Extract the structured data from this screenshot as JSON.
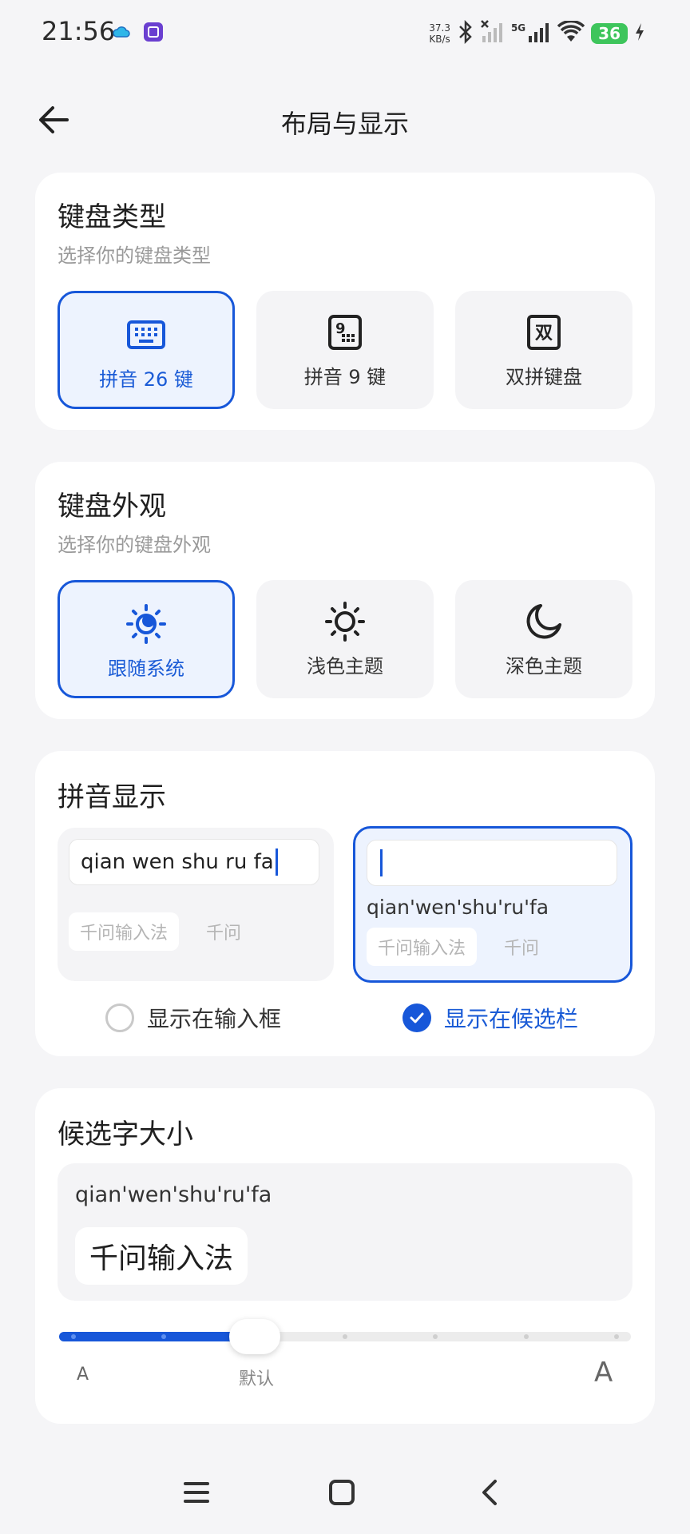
{
  "status_bar": {
    "time": "21:56",
    "net_speed_value": "37.3",
    "net_speed_unit": "KB/s",
    "network_type": "5G",
    "battery_level": "36",
    "battery_color": "#3ec55c"
  },
  "header": {
    "title": "布局与显示"
  },
  "keyboard_type": {
    "title": "键盘类型",
    "subtitle": "选择你的键盘类型",
    "options": [
      {
        "label": "拼音 26 键",
        "icon": "keyboard-26-icon",
        "selected": true
      },
      {
        "label": "拼音 9 键",
        "icon": "keyboard-9-icon",
        "selected": false
      },
      {
        "label": "双拼键盘",
        "icon": "shuangpin-icon",
        "icon_text": "双",
        "selected": false
      }
    ]
  },
  "appearance": {
    "title": "键盘外观",
    "subtitle": "选择你的键盘外观",
    "options": [
      {
        "label": "跟随系统",
        "icon": "follow-system-icon",
        "selected": true
      },
      {
        "label": "浅色主题",
        "icon": "sun-icon",
        "selected": false
      },
      {
        "label": "深色主题",
        "icon": "moon-icon",
        "selected": false
      }
    ]
  },
  "pinyin_display": {
    "title": "拼音显示",
    "left_preview": {
      "input_text": "qian wen shu ru fa",
      "candidates": [
        "千问输入法",
        "千问"
      ]
    },
    "right_preview": {
      "pinyin": "qian'wen'shu'ru'fa",
      "candidates": [
        "千问输入法",
        "千问"
      ]
    },
    "option_input": "显示在输入框",
    "option_candidate": "显示在候选栏",
    "selected": "candidate"
  },
  "candidate_size": {
    "title": "候选字大小",
    "preview_pinyin": "qian'wen'shu'ru'fa",
    "preview_candidate": "千问输入法",
    "label_small": "A",
    "label_default": "默认",
    "label_large": "A",
    "steps": 7,
    "level_index": 2
  },
  "accent_color": "#1757d9"
}
